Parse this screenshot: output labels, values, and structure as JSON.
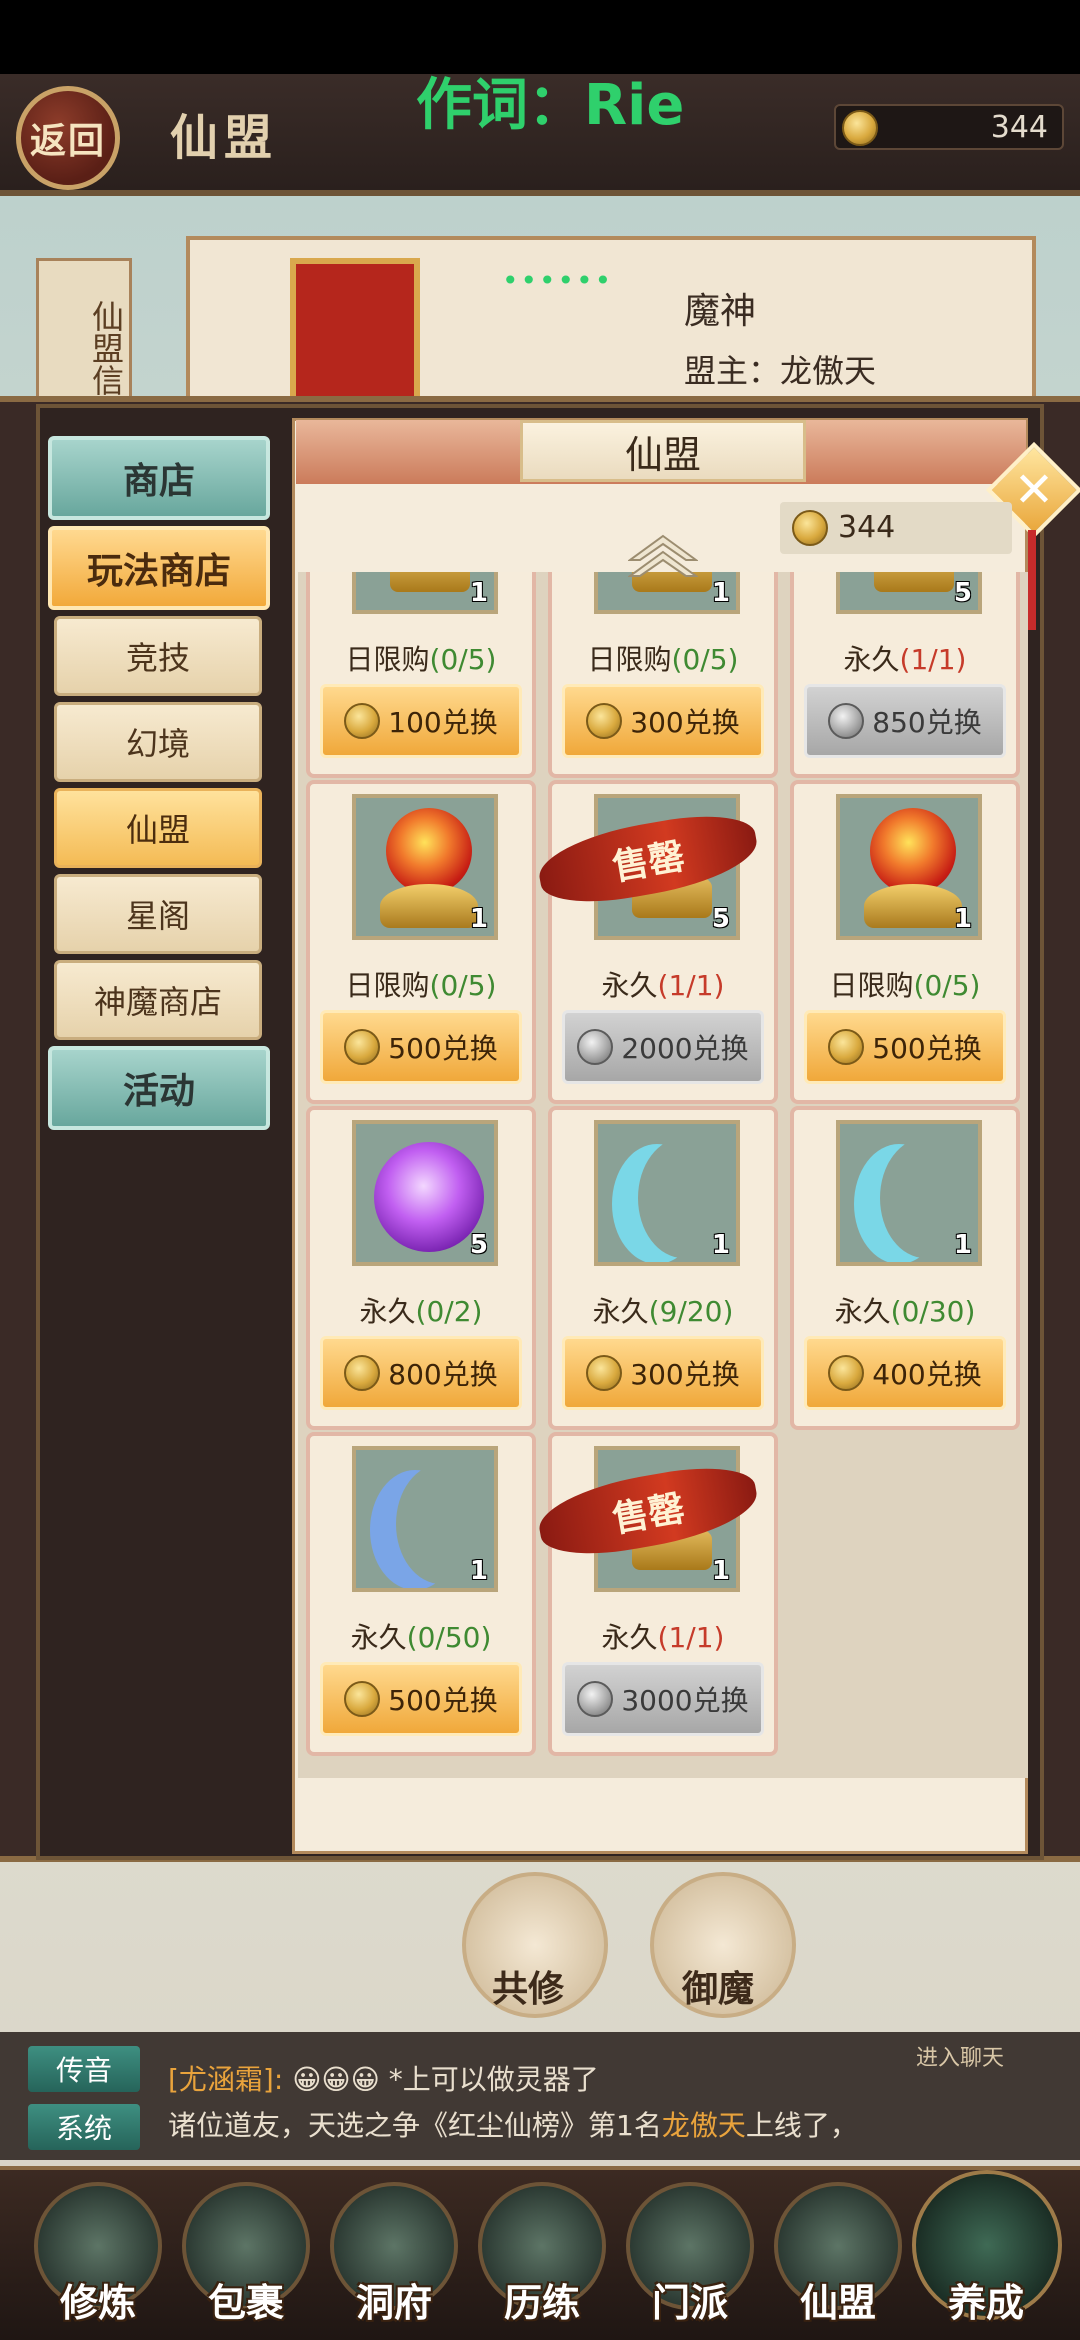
{
  "header": {
    "back_label": "返回",
    "title": "仙盟",
    "currency": "344"
  },
  "overlay_lyric": "作词：Rie",
  "guild": {
    "side_tag": "仙盟信",
    "name": "魔神",
    "leader_label": "盟主：",
    "leader_name": "龙傲天"
  },
  "shop": {
    "title": "仙盟",
    "currency": "344",
    "nav": {
      "shop": "商店",
      "gameplay_shop": "玩法商店",
      "sub": [
        "竞技",
        "幻境",
        "仙盟",
        "星阁",
        "神魔商店"
      ],
      "activity": "活动"
    },
    "sold_out_label": "售罄",
    "items": [
      {
        "count": "1",
        "limit_prefix": "日限购",
        "limit_count": "(0/5)",
        "limit_color": "green",
        "price": "100兑换",
        "disabled": false,
        "art": "chest"
      },
      {
        "count": "1",
        "limit_prefix": "日限购",
        "limit_count": "(0/5)",
        "limit_color": "green",
        "price": "300兑换",
        "disabled": false,
        "art": "chest"
      },
      {
        "count": "5",
        "limit_prefix": "永久",
        "limit_count": "(1/1)",
        "limit_color": "red",
        "price": "850兑换",
        "disabled": true,
        "art": "chest"
      },
      {
        "count": "1",
        "limit_prefix": "日限购",
        "limit_count": "(0/5)",
        "limit_color": "green",
        "price": "500兑换",
        "disabled": false,
        "art": "orb"
      },
      {
        "count": "5",
        "limit_prefix": "永久",
        "limit_count": "(1/1)",
        "limit_color": "red",
        "price": "2000兑换",
        "disabled": true,
        "art": "sold"
      },
      {
        "count": "1",
        "limit_prefix": "日限购",
        "limit_count": "(0/5)",
        "limit_color": "green",
        "price": "500兑换",
        "disabled": false,
        "art": "orb"
      },
      {
        "count": "5",
        "limit_prefix": "永久",
        "limit_count": "(0/2)",
        "limit_color": "green",
        "price": "800兑换",
        "disabled": false,
        "art": "purple"
      },
      {
        "count": "1",
        "limit_prefix": "永久",
        "limit_count": "(9/20)",
        "limit_color": "green",
        "price": "300兑换",
        "disabled": false,
        "art": "moon"
      },
      {
        "count": "1",
        "limit_prefix": "永久",
        "limit_count": "(0/30)",
        "limit_color": "green",
        "price": "400兑换",
        "disabled": false,
        "art": "moon"
      },
      {
        "count": "1",
        "limit_prefix": "永久",
        "limit_count": "(0/50)",
        "limit_color": "green",
        "price": "500兑换",
        "disabled": false,
        "art": "moon2"
      },
      {
        "count": "1",
        "limit_prefix": "永久",
        "limit_count": "(1/1)",
        "limit_color": "red",
        "price": "3000兑换",
        "disabled": true,
        "art": "sold"
      }
    ]
  },
  "actions": {
    "co_cultivate": "共修",
    "resist_demon": "御魔"
  },
  "chat": {
    "tag_rumor": "传音",
    "tag_system": "系统",
    "line1_name": "[尤涵霜]:",
    "line1_emotes": "😀😀😀",
    "line1_text": "*上可以做灵器了",
    "line2_pre": "诸位道友，天选之争《红尘仙榜》第1名",
    "line2_hl": "龙傲天",
    "line2_post": "上线了，",
    "enter_chat": "进入聊天"
  },
  "bottom_tabs": [
    "修炼",
    "包裹",
    "洞府",
    "历练",
    "门派",
    "仙盟",
    "养成"
  ]
}
